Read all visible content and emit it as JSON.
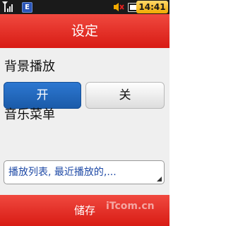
{
  "status_bar": {
    "network_icon_label": "E",
    "time": "14:41",
    "battery_level": 0.9
  },
  "header": {
    "title": "设定"
  },
  "background_play": {
    "label": "背景播放",
    "on_label": "开",
    "off_label": "关",
    "selected": "on"
  },
  "music_menu": {
    "label": "音乐菜单",
    "value": "播放列表, 最近播放的,..."
  },
  "footer": {
    "save_label": "储存"
  },
  "icons": {
    "signal": "signal-strength-icon",
    "network": "edge-network-icon",
    "mute": "mute-icon",
    "battery": "battery-icon",
    "dropdown": "dropdown-corner-icon"
  },
  "colors": {
    "accent_red": "#d81b14",
    "selected_blue": "#1a5aa8",
    "status_bar": "#1a1a1a",
    "clock_bg": "#f0a900"
  },
  "watermark": "iTcom.cn"
}
